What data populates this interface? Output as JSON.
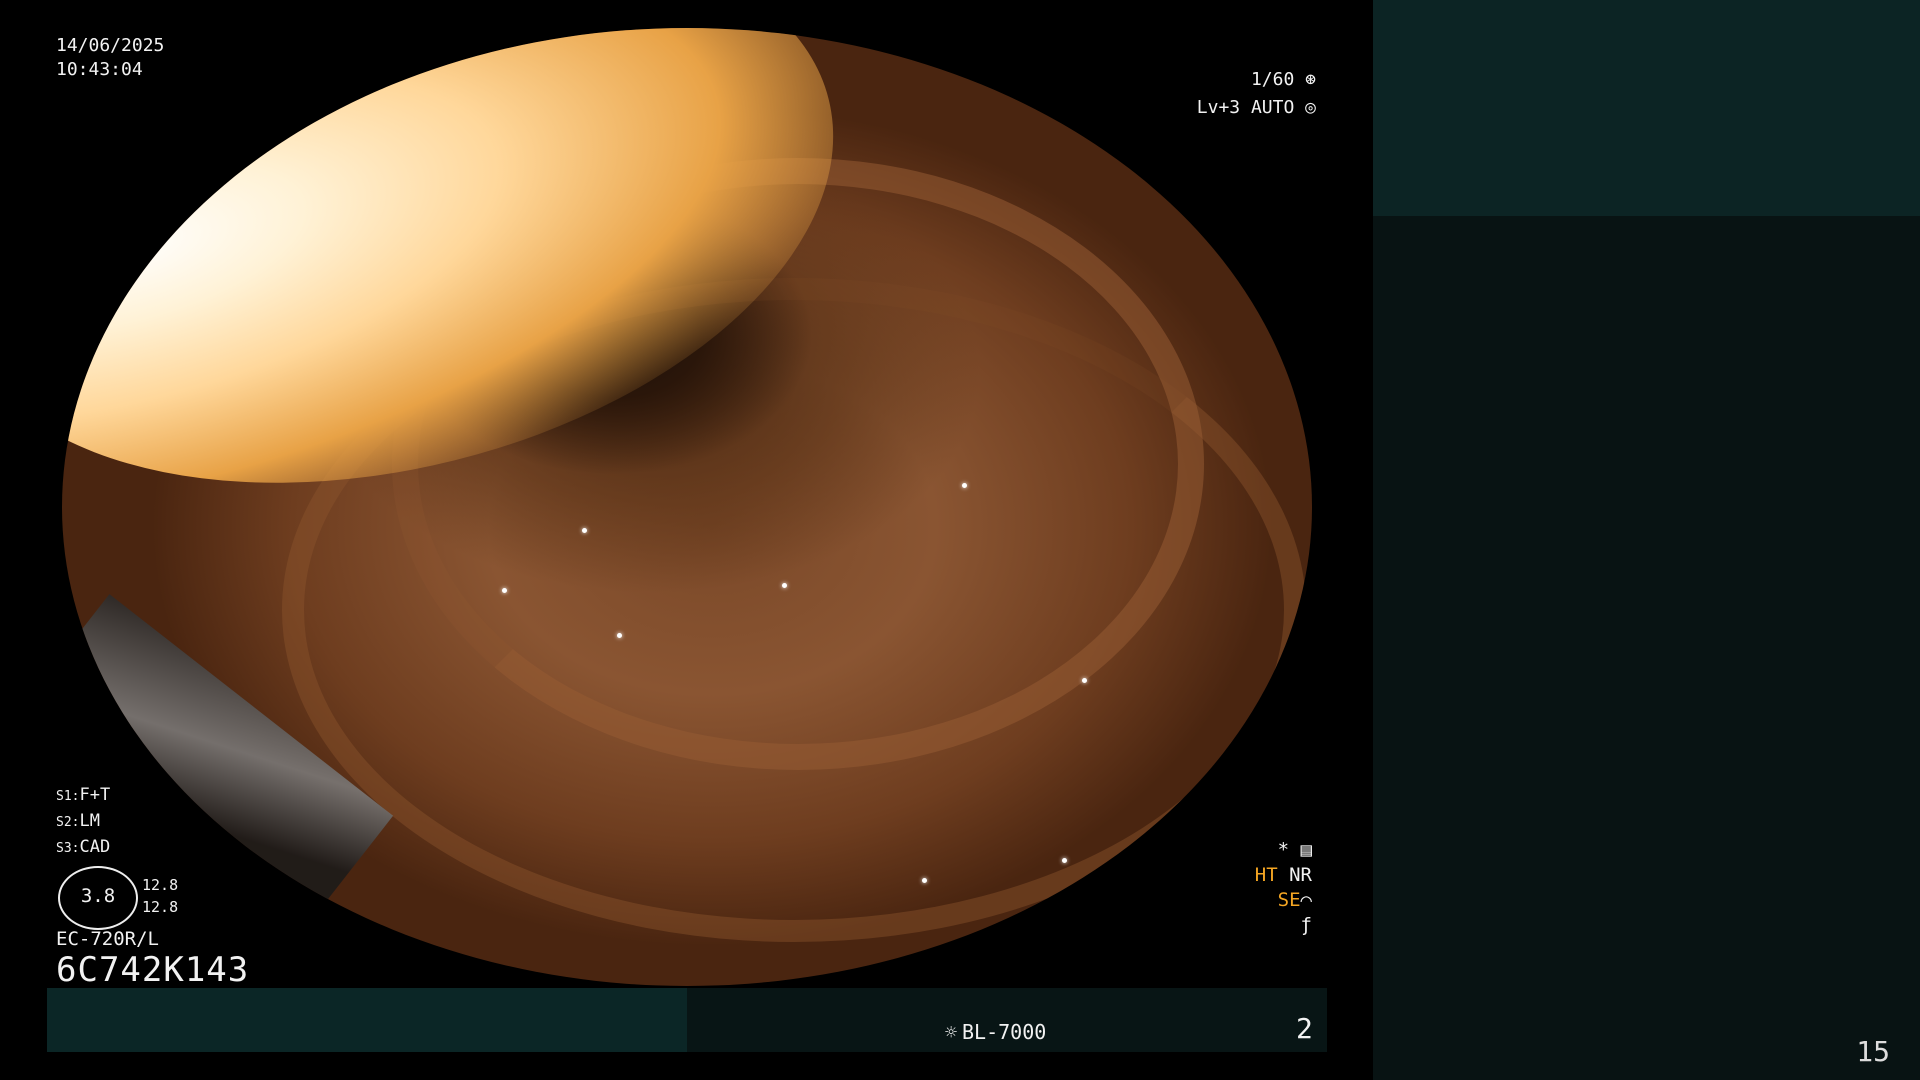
{
  "overlay": {
    "date": "14/06/2025",
    "time": "10:43:04",
    "shutter": "1/60",
    "level": "Lv+3  AUTO",
    "modes": [
      {
        "label": "S1:",
        "value": "F+T"
      },
      {
        "label": "S2:",
        "value": "LM"
      },
      {
        "label": "S3:",
        "value": "CAD"
      }
    ],
    "gauge_value": "3.8",
    "gauge_values": [
      "12.8",
      "12.8"
    ],
    "scope_model": "EC-720R/L",
    "serial": "6C742K143",
    "right_indicators": {
      "star": "*",
      "ht": "HT",
      "nr": "NR",
      "se": "SE"
    },
    "light_source": "BL-7000",
    "frame_number": "2"
  },
  "page_number": "15",
  "icons": [
    "shutter-icon",
    "auto-icon",
    "settings-icon",
    "sun-icon",
    "tone-icon"
  ],
  "colors": {
    "accent": "#f5a623",
    "bar": "#0b2626",
    "panel": "#081313"
  }
}
